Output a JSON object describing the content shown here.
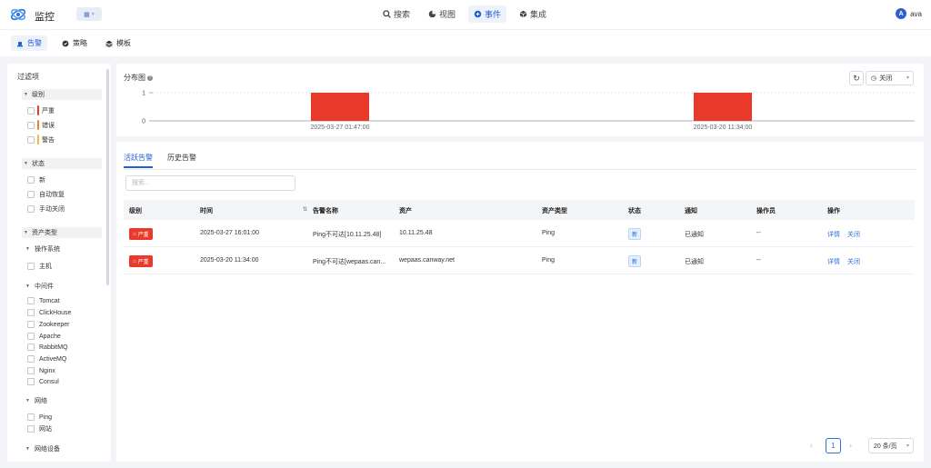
{
  "app": {
    "title": "监控"
  },
  "nav": [
    {
      "label": "搜索",
      "icon": "search-icon",
      "active": false
    },
    {
      "label": "视图",
      "icon": "pie-icon",
      "active": false
    },
    {
      "label": "事件",
      "icon": "event-icon",
      "active": true
    },
    {
      "label": "集成",
      "icon": "cube-icon",
      "active": false
    }
  ],
  "user": {
    "initial": "A",
    "name": "ava"
  },
  "subtabs": [
    {
      "label": "告警",
      "icon": "alarm-icon",
      "active": true
    },
    {
      "label": "策略",
      "icon": "policy-icon",
      "active": false
    },
    {
      "label": "模板",
      "icon": "layers-icon",
      "active": false
    }
  ],
  "filters": {
    "title": "过滤项",
    "level": {
      "label": "级别",
      "options": [
        {
          "label": "严重",
          "color": "#e9392b"
        },
        {
          "label": "错误",
          "color": "#e8832a"
        },
        {
          "label": "警告",
          "color": "#f5b83d"
        }
      ]
    },
    "status": {
      "label": "状态",
      "options": [
        "新",
        "自动恢复",
        "手动关闭"
      ]
    },
    "asset": {
      "label": "资产类型",
      "os": {
        "label": "操作系统",
        "options": [
          "主机"
        ]
      },
      "middleware": {
        "label": "中间件",
        "options": [
          "Tomcat",
          "ClickHouse",
          "Zookeeper",
          "Apache",
          "RabbitMQ",
          "ActiveMQ",
          "Nginx",
          "Consul"
        ]
      },
      "network": {
        "label": "网络",
        "options": [
          "Ping",
          "网站"
        ]
      },
      "netdevice": {
        "label": "网络设备"
      }
    }
  },
  "distribution": {
    "title": "分布图",
    "close_label": "关闭"
  },
  "chart_data": {
    "type": "bar",
    "categories": [
      "2025-03-27 01:47:00",
      "2025-03-20 11:34:00"
    ],
    "values": [
      1,
      1
    ],
    "color": "#e9392b",
    "yticks": [
      0,
      1
    ],
    "ylim": [
      0,
      1
    ]
  },
  "tabs": [
    {
      "label": "活跃告警",
      "active": true
    },
    {
      "label": "历史告警",
      "active": false
    }
  ],
  "search": {
    "placeholder": "搜索..."
  },
  "table": {
    "columns": [
      "级别",
      "时间",
      "告警名称",
      "资产",
      "资产类型",
      "状态",
      "通知",
      "操作员",
      "操作"
    ],
    "rows": [
      {
        "level": "严重",
        "time": "2025-03-27 16:01:00",
        "name": "Ping不可达[10.11.25.48]",
        "asset": "10.11.25.48",
        "type": "Ping",
        "status": "新",
        "notify": "已通知",
        "operator": "--",
        "detail": "详情",
        "close": "关闭"
      },
      {
        "level": "严重",
        "time": "2025-03-20 11:34:00",
        "name": "Ping不可达[wepaas.can...",
        "asset": "wepaas.canway.net",
        "type": "Ping",
        "status": "新",
        "notify": "已通知",
        "operator": "--",
        "detail": "详情",
        "close": "关闭"
      }
    ]
  },
  "pagination": {
    "page": "1",
    "page_size": "20 条/页"
  }
}
